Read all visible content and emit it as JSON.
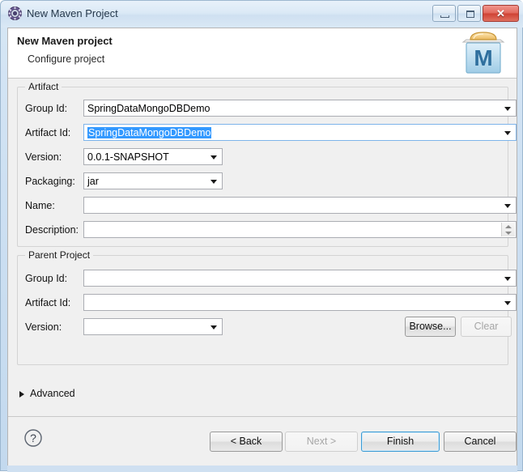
{
  "window": {
    "title": "New Maven Project",
    "icon": "maven-gear-icon",
    "controls": {
      "minimize_label": "–",
      "maximize_label": "□",
      "close_label": "✕"
    }
  },
  "header": {
    "title": "New Maven project",
    "subtitle": "Configure project",
    "logo": "maven-m-logo"
  },
  "artifact": {
    "legend": "Artifact",
    "fields": [
      {
        "label": "Group Id:",
        "value": "SpringDataMongoDBDemo",
        "type": "combo",
        "focused": false,
        "selected": false
      },
      {
        "label": "Artifact Id:",
        "value": "SpringDataMongoDBDemo",
        "type": "combo",
        "focused": true,
        "selected": true
      },
      {
        "label": "Version:",
        "value": "0.0.1-SNAPSHOT",
        "type": "combo",
        "focused": false,
        "selected": false
      },
      {
        "label": "Packaging:",
        "value": "jar",
        "type": "combo",
        "focused": false,
        "selected": false
      },
      {
        "label": "Name:",
        "value": "",
        "type": "combo",
        "focused": false,
        "selected": false
      },
      {
        "label": "Description:",
        "value": "",
        "type": "textarea",
        "focused": false,
        "selected": false
      }
    ]
  },
  "parent": {
    "legend": "Parent Project",
    "fields": [
      {
        "label": "Group Id:",
        "value": "",
        "type": "combo"
      },
      {
        "label": "Artifact Id:",
        "value": "",
        "type": "combo"
      },
      {
        "label": "Version:",
        "value": "",
        "type": "combo"
      }
    ],
    "browse_label": "Browse...",
    "clear_label": "Clear"
  },
  "advanced": {
    "label": "Advanced",
    "expanded": false
  },
  "footer": {
    "help_icon": "question-mark-icon",
    "back_label": "< Back",
    "next_label": "Next >",
    "finish_label": "Finish",
    "cancel_label": "Cancel"
  },
  "colors": {
    "frame": "#cfe0f1",
    "dialog_bg": "#f0f0f0",
    "selection": "#3399ff",
    "focus_border": "#7eb4ea",
    "close_button": "#cf4234"
  }
}
